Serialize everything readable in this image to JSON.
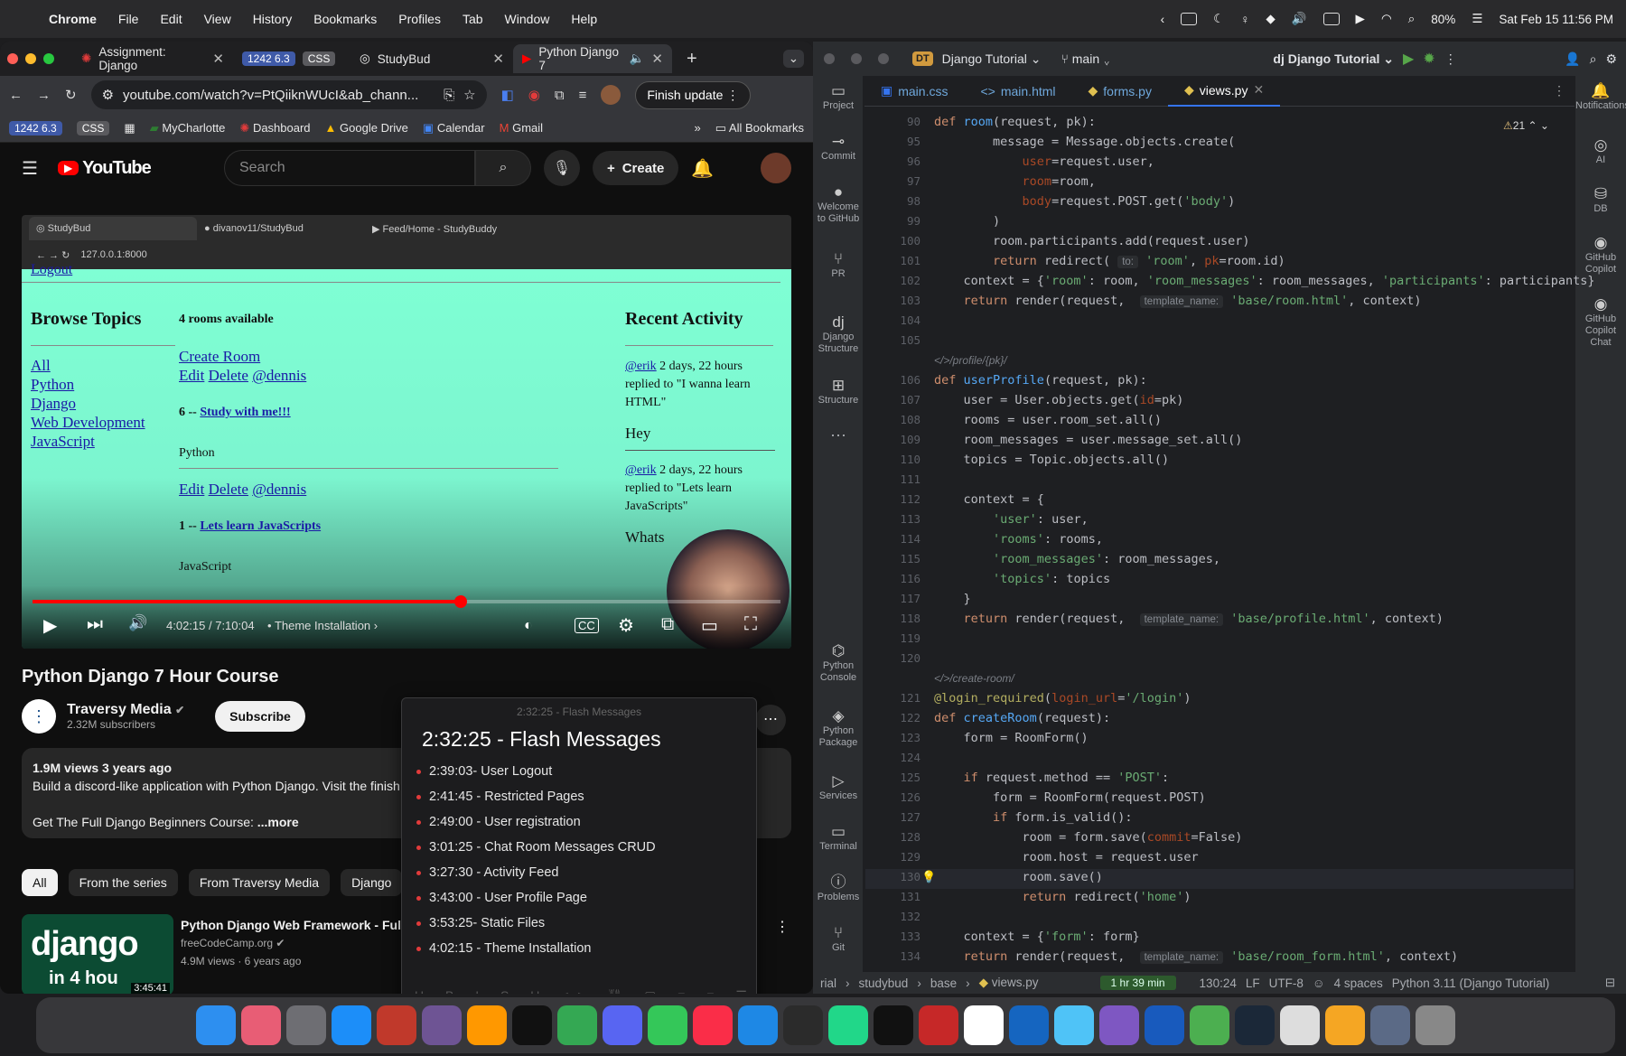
{
  "menubar": {
    "app": "Chrome",
    "items": [
      "File",
      "Edit",
      "View",
      "History",
      "Bookmarks",
      "Profiles",
      "Tab",
      "Window",
      "Help"
    ],
    "battery": "80%",
    "clock": "Sat Feb 15  11:56 PM"
  },
  "chrome": {
    "tabs": [
      {
        "label": "Assignment: Django"
      },
      {
        "label": "1242 6.3",
        "pill": "CSS"
      },
      {
        "label": "StudyBud"
      },
      {
        "label": "Python Django 7"
      }
    ],
    "url": "youtube.com/watch?v=PtQiiknWUcI&ab_chann...",
    "finish_update": "Finish update",
    "bookmarks": [
      "1242 6.3",
      "CSS",
      "MyCharlotte",
      "Dashboard",
      "Google Drive",
      "Calendar",
      "Gmail"
    ],
    "all_bookmarks": "All Bookmarks"
  },
  "youtube": {
    "logo": "YouTube",
    "search_placeholder": "Search",
    "create": "Create",
    "video": {
      "inner_tabs": [
        "StudyBud",
        "divanov11/StudyBud",
        "▶ Feed/Home - StudyBuddy"
      ],
      "inner_url": "127.0.0.1:8000",
      "site": {
        "logout": "Logout",
        "browse_title": "Browse Topics",
        "topics": [
          "All",
          "Python",
          "Django",
          "Web Development",
          "JavaScript"
        ],
        "rooms_available": "4 rooms available",
        "create_room": "Create Room",
        "edit": "Edit",
        "delete": "Delete",
        "user1": "@dennis",
        "room1_prefix": "6 -- ",
        "room1": "Study with me!!!",
        "room1_topic": "Python",
        "room2_prefix": "1 -- ",
        "room2": "Lets learn JavaScripts",
        "room2_topic": "JavaScript",
        "recent_title": "Recent Activity",
        "activity1_user": "@erik",
        "activity1_text": "2 days, 22 hours replied to \"I wanna learn HTML\"",
        "activity1_msg": "Hey",
        "activity2_user": "@erik",
        "activity2_text": "2 days, 22 hours replied to \"Lets learn JavaScripts\"",
        "activity2_msg": "Whats"
      },
      "progress": 0.5727,
      "time": "4:02:15 / 7:10:04",
      "chapter": "Theme Installation"
    },
    "title": "Python Django 7 Hour Course",
    "channel": "Traversy Media",
    "subscribers": "2.32M subscribers",
    "subscribe": "Subscribe",
    "views_line": "1.9M views  3 years ago",
    "desc1": "Build a discord-like application with Python Django. Visit the finish",
    "desc2": "Get The Full Django Beginners Course:",
    "more": "...more",
    "chips": [
      "All",
      "From the series",
      "From Traversy Media",
      "Django"
    ],
    "rec": {
      "title": "Python Django Web Framework - Full C",
      "channel": "freeCodeCamp.org",
      "meta": "4.9M views · 6 years ago",
      "duration": "3:45:41",
      "thumb_text": "django",
      "thumb_sub": "in 4 hou"
    }
  },
  "chapters": {
    "header": "2:32:25 - Flash Messages",
    "title": "2:32:25 - Flash Messages",
    "items": [
      "2:39:03- User Logout",
      "2:41:45 - Restricted Pages",
      "2:49:00 - User registration",
      "3:01:25 -  Chat Room Messages CRUD",
      "3:27:30 - Activity Feed",
      "3:43:00 - User Profile Page",
      "3:53:25- Static Files",
      "4:02:15 - Theme Installation"
    ]
  },
  "ide": {
    "project": "Django Tutorial",
    "project_badge": "DT",
    "branch": "main",
    "run_config": "Django Tutorial",
    "tabs": [
      "main.css",
      "main.html",
      "forms.py",
      "views.py"
    ],
    "warnings": "21",
    "left_rail": [
      "Project",
      "Commit",
      "Welcome to GitHub",
      "PR",
      "Django Structure",
      "Structure",
      "Python Console",
      "Python Package",
      "Services",
      "Terminal",
      "Problems",
      "Git"
    ],
    "right_rail": [
      "Notifications",
      "AI",
      "DB",
      "GitHub Copilot",
      "GitHub Copilot Chat"
    ],
    "status": {
      "crumbs": [
        "rial",
        "studybud",
        "base",
        "views.py"
      ],
      "timer": "1 hr 39 min",
      "pos": "130:24",
      "lf": "LF",
      "enc": "UTF-8",
      "indent": "4 spaces",
      "interp": "Python 3.11 (Django Tutorial)"
    }
  },
  "code_lines": [
    {
      "n": "90",
      "t": "def room(request, pk):"
    },
    {
      "n": "95",
      "t": "        message = Message.objects.create("
    },
    {
      "n": "96",
      "t": "            user=request.user,"
    },
    {
      "n": "97",
      "t": "            room=room,"
    },
    {
      "n": "98",
      "t": "            body=request.POST.get('body')"
    },
    {
      "n": "99",
      "t": "        )"
    },
    {
      "n": "100",
      "t": "        room.participants.add(request.user)"
    },
    {
      "n": "101",
      "t": "        return redirect( to: 'room', pk=room.id)"
    },
    {
      "n": "102",
      "t": "    context = {'room': room, 'room_messages': room_messages, 'participants': participants}"
    },
    {
      "n": "103",
      "t": "    return render(request,  template_name: 'base/room.html', context)"
    },
    {
      "n": "104",
      "t": ""
    },
    {
      "n": "105",
      "t": ""
    },
    {
      "n": "",
      "t": "/profile/{pk}/"
    },
    {
      "n": "106",
      "t": "def userProfile(request, pk):"
    },
    {
      "n": "107",
      "t": "    user = User.objects.get(id=pk)"
    },
    {
      "n": "108",
      "t": "    rooms = user.room_set.all()"
    },
    {
      "n": "109",
      "t": "    room_messages = user.message_set.all()"
    },
    {
      "n": "110",
      "t": "    topics = Topic.objects.all()"
    },
    {
      "n": "111",
      "t": ""
    },
    {
      "n": "112",
      "t": "    context = {"
    },
    {
      "n": "113",
      "t": "        'user': user,"
    },
    {
      "n": "114",
      "t": "        'rooms': rooms,"
    },
    {
      "n": "115",
      "t": "        'room_messages': room_messages,"
    },
    {
      "n": "116",
      "t": "        'topics': topics"
    },
    {
      "n": "117",
      "t": "    }"
    },
    {
      "n": "118",
      "t": "    return render(request,  template_name: 'base/profile.html', context)"
    },
    {
      "n": "119",
      "t": ""
    },
    {
      "n": "120",
      "t": ""
    },
    {
      "n": "",
      "t": "/create-room/"
    },
    {
      "n": "121",
      "t": "@login_required(login_url='/login')"
    },
    {
      "n": "122",
      "t": "def createRoom(request):"
    },
    {
      "n": "123",
      "t": "    form = RoomForm()"
    },
    {
      "n": "124",
      "t": ""
    },
    {
      "n": "125",
      "t": "    if request.method == 'POST':"
    },
    {
      "n": "126",
      "t": "        form = RoomForm(request.POST)"
    },
    {
      "n": "127",
      "t": "        if form.is_valid():"
    },
    {
      "n": "128",
      "t": "            room = form.save(commit=False)"
    },
    {
      "n": "129",
      "t": "            room.host = request.user"
    },
    {
      "n": "130",
      "t": "            room.save()"
    },
    {
      "n": "131",
      "t": "            return redirect('home')"
    },
    {
      "n": "132",
      "t": ""
    },
    {
      "n": "133",
      "t": "    context = {'form': form}"
    },
    {
      "n": "134",
      "t": "    return render(request,  template_name: 'base/room_form.html', context)"
    }
  ],
  "dock": [
    "Finder",
    "Launchpad",
    "Settings",
    "App Store",
    "Raycast",
    "GitHub",
    "Sublime",
    "ChatGPT",
    "Chrome",
    "Discord",
    "Messages",
    "Music",
    "VS Code",
    "WebStorm",
    "PyCharm",
    "Terminal",
    "FileZilla",
    "Simulator",
    "Xcode",
    "Weather",
    "Obsidian",
    "Word",
    "Maps",
    "Steam",
    "Roblox",
    "Notes",
    "Files",
    "Trash"
  ]
}
